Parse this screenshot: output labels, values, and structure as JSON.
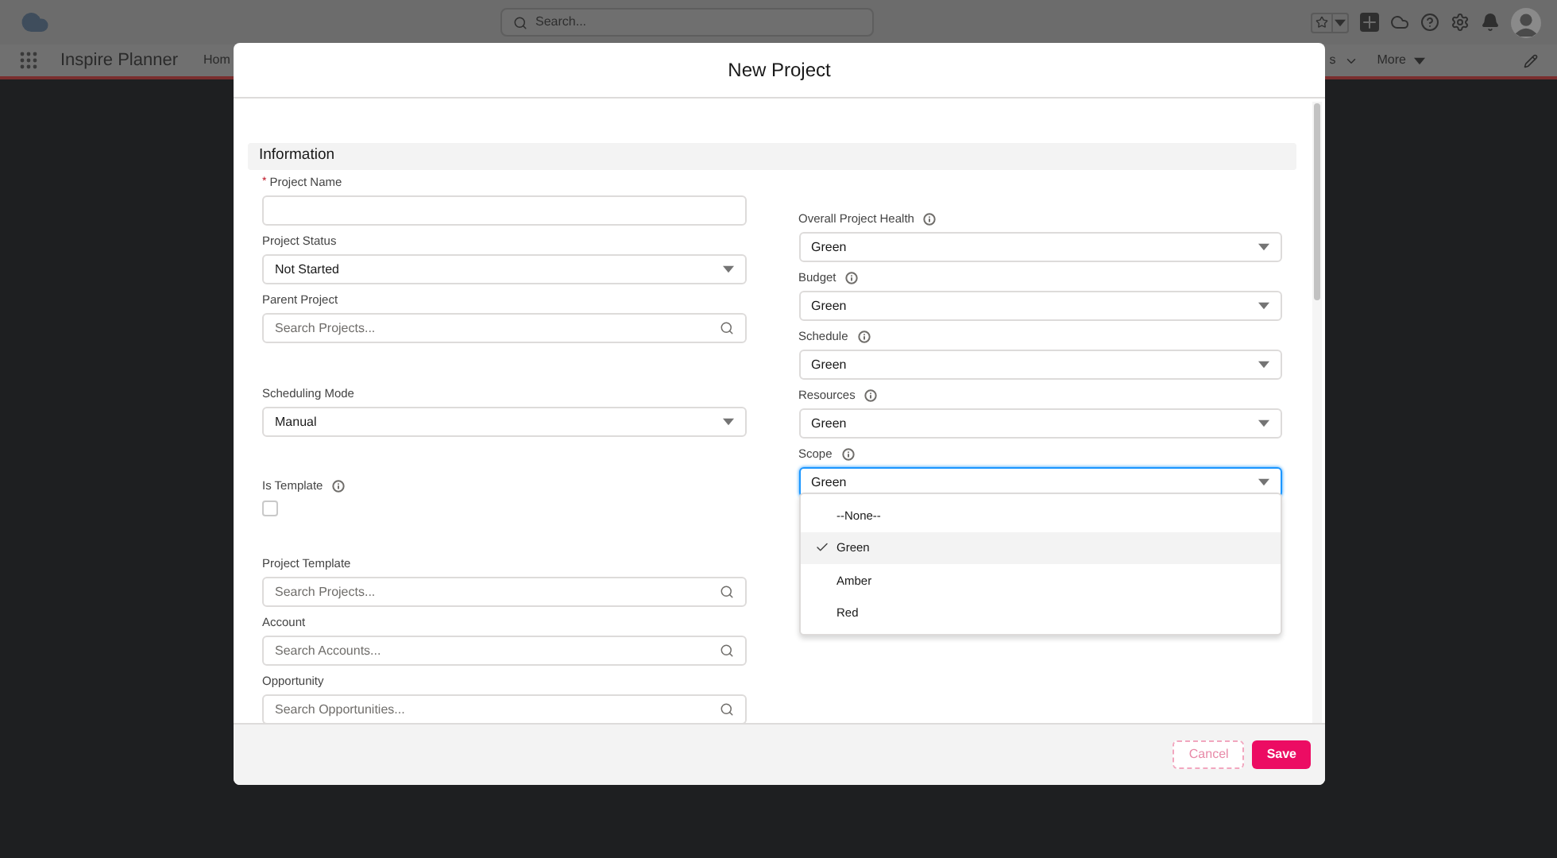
{
  "app_header": {
    "search": {
      "placeholder": "Search..."
    },
    "app_name": "Inspire Planner",
    "nav_items": [
      {
        "label": "Hom",
        "kind": "plain"
      },
      {
        "label": "s",
        "kind": "chevron"
      },
      {
        "label": "More",
        "kind": "caret"
      }
    ]
  },
  "modal": {
    "title": "New Project",
    "section": "Information",
    "required_mark": "*",
    "left_fields": [
      {
        "kind": "text",
        "label": "Project Name",
        "required": true,
        "info": false
      },
      {
        "kind": "select",
        "label": "Project Status",
        "required": false,
        "info": false,
        "value": "Not Started"
      },
      {
        "kind": "lookup",
        "label": "Parent Project",
        "required": false,
        "info": false,
        "placeholder": "Search Projects..."
      },
      {
        "kind": "select",
        "label": "Scheduling Mode",
        "required": false,
        "info": false,
        "value": "Manual"
      },
      {
        "kind": "checkbox",
        "label": "Is Template",
        "required": false,
        "info": true,
        "checked": false
      },
      {
        "kind": "lookup",
        "label": "Project Template",
        "required": false,
        "info": false,
        "placeholder": "Search Projects..."
      },
      {
        "kind": "lookup",
        "label": "Account",
        "required": false,
        "info": false,
        "placeholder": "Search Accounts..."
      },
      {
        "kind": "lookup",
        "label": "Opportunity",
        "required": false,
        "info": false,
        "placeholder": "Search Opportunities..."
      }
    ],
    "right_fields": [
      {
        "kind": "select",
        "label": "Overall Project Health",
        "required": false,
        "info": true,
        "value": "Green",
        "focused": false
      },
      {
        "kind": "select",
        "label": "Budget",
        "required": false,
        "info": true,
        "value": "Green",
        "focused": false
      },
      {
        "kind": "select",
        "label": "Schedule",
        "required": false,
        "info": true,
        "value": "Green",
        "focused": false
      },
      {
        "kind": "select",
        "label": "Resources",
        "required": false,
        "info": true,
        "value": "Green",
        "focused": false
      },
      {
        "kind": "select",
        "label": "Scope",
        "required": false,
        "info": true,
        "value": "Green",
        "focused": true
      }
    ],
    "dropdown": {
      "options": [
        {
          "label": "--None--",
          "selected": false
        },
        {
          "label": "Green",
          "selected": true
        },
        {
          "label": "Amber",
          "selected": false
        },
        {
          "label": "Red",
          "selected": false
        }
      ]
    },
    "buttons": [
      {
        "label": "Cancel",
        "kind": "neutral"
      },
      {
        "label": "Save",
        "kind": "brand"
      }
    ]
  }
}
